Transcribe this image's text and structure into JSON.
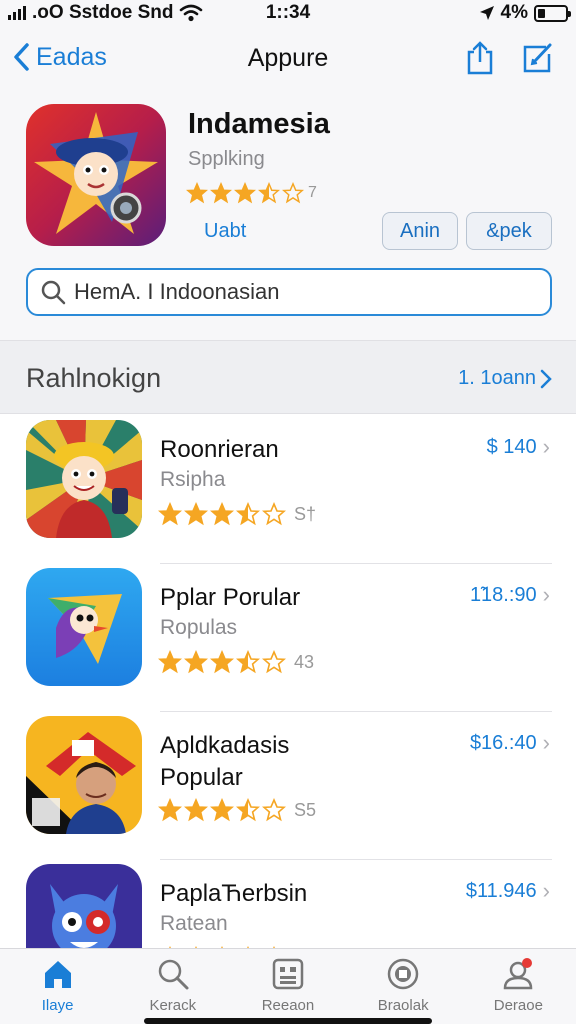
{
  "status": {
    "carrier": ".oO Sstdoe Snd",
    "time": "1::34",
    "battery": "4%",
    "icons": [
      "signal-icon",
      "wifi-icon",
      "location-icon",
      "battery-icon"
    ]
  },
  "nav": {
    "back_label": "Eadas",
    "title": "Appure",
    "icons": [
      "share-icon",
      "edit-icon"
    ]
  },
  "featured": {
    "name": "Indamesia",
    "subtitle": "Spplking",
    "rating": 3.5,
    "rating_count": "7",
    "update_label": "Uabt",
    "button_1": "Anin",
    "button_2": "&pek",
    "icon": "app-mascot-icon"
  },
  "search": {
    "value": "HemA. I Indoonasian"
  },
  "section": {
    "title": "Rahlnokign",
    "see_all": "1. 1oann"
  },
  "apps": [
    {
      "name": "Roonrieran",
      "sub": "Rsipha",
      "rating": 3.5,
      "count": "S†",
      "price": "$ 140"
    },
    {
      "name": "Pplar Porular",
      "sub": "Ropulas",
      "rating": 3.5,
      "count": "43",
      "price": "1̃18.:90"
    },
    {
      "name": "Apldkadasis",
      "name2": "Popular",
      "sub": "",
      "rating": 3.5,
      "count": "S5",
      "price": "$16.:40"
    },
    {
      "name": "PaplaЋerbsin",
      "sub": "Ratean",
      "rating": 3.5,
      "count": "",
      "price": "$11.946"
    }
  ],
  "tabs": [
    {
      "label": "Ilaye",
      "icon": "home-icon",
      "active": true
    },
    {
      "label": "Kerack",
      "icon": "search-icon",
      "active": false
    },
    {
      "label": "Reeaon",
      "icon": "apps-icon",
      "active": false
    },
    {
      "label": "Braolak",
      "icon": "arcade-icon",
      "active": false
    },
    {
      "label": "Deraoe",
      "icon": "account-icon",
      "active": false
    }
  ],
  "colors": {
    "accent": "#1a7ed6",
    "star": "#f5a623",
    "badge": "#e53935"
  }
}
